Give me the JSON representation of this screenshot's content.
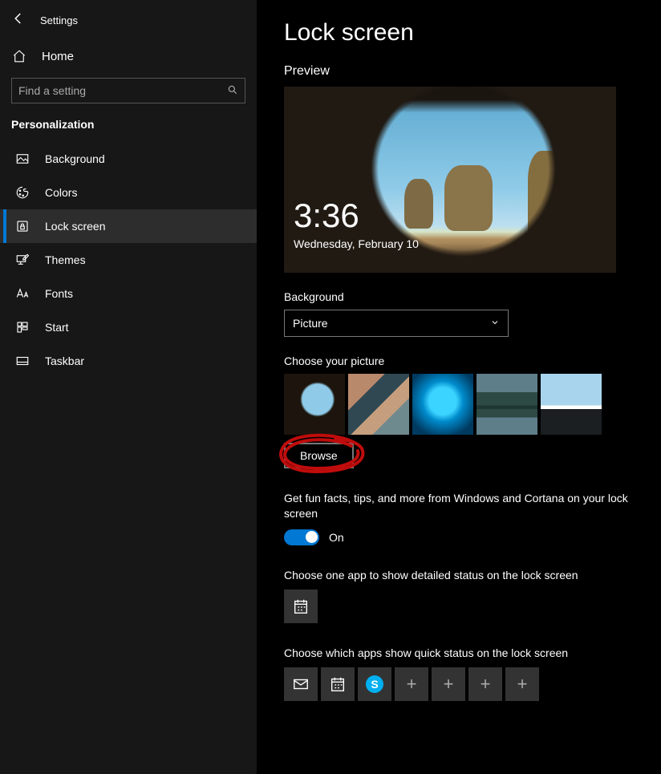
{
  "app_title": "Settings",
  "home_label": "Home",
  "search_placeholder": "Find a setting",
  "section_header": "Personalization",
  "nav": [
    {
      "label": "Background",
      "icon": "picture-icon"
    },
    {
      "label": "Colors",
      "icon": "palette-icon"
    },
    {
      "label": "Lock screen",
      "icon": "lockscreen-icon",
      "selected": true
    },
    {
      "label": "Themes",
      "icon": "themes-icon"
    },
    {
      "label": "Fonts",
      "icon": "fonts-icon"
    },
    {
      "label": "Start",
      "icon": "start-icon"
    },
    {
      "label": "Taskbar",
      "icon": "taskbar-icon"
    }
  ],
  "page_title": "Lock screen",
  "preview_label": "Preview",
  "preview_time": "3:36",
  "preview_date": "Wednesday, February 10",
  "bg_label": "Background",
  "bg_value": "Picture",
  "choose_picture_label": "Choose your picture",
  "browse_label": "Browse",
  "fun_facts_text": "Get fun facts, tips, and more from Windows and Cortana on your lock screen",
  "fun_facts_state": "On",
  "detailed_status_label": "Choose one app to show detailed status on the lock screen",
  "quick_status_label": "Choose which apps show quick status on the lock screen",
  "annotation": {
    "target": "browse-button",
    "style": "red-circle"
  }
}
